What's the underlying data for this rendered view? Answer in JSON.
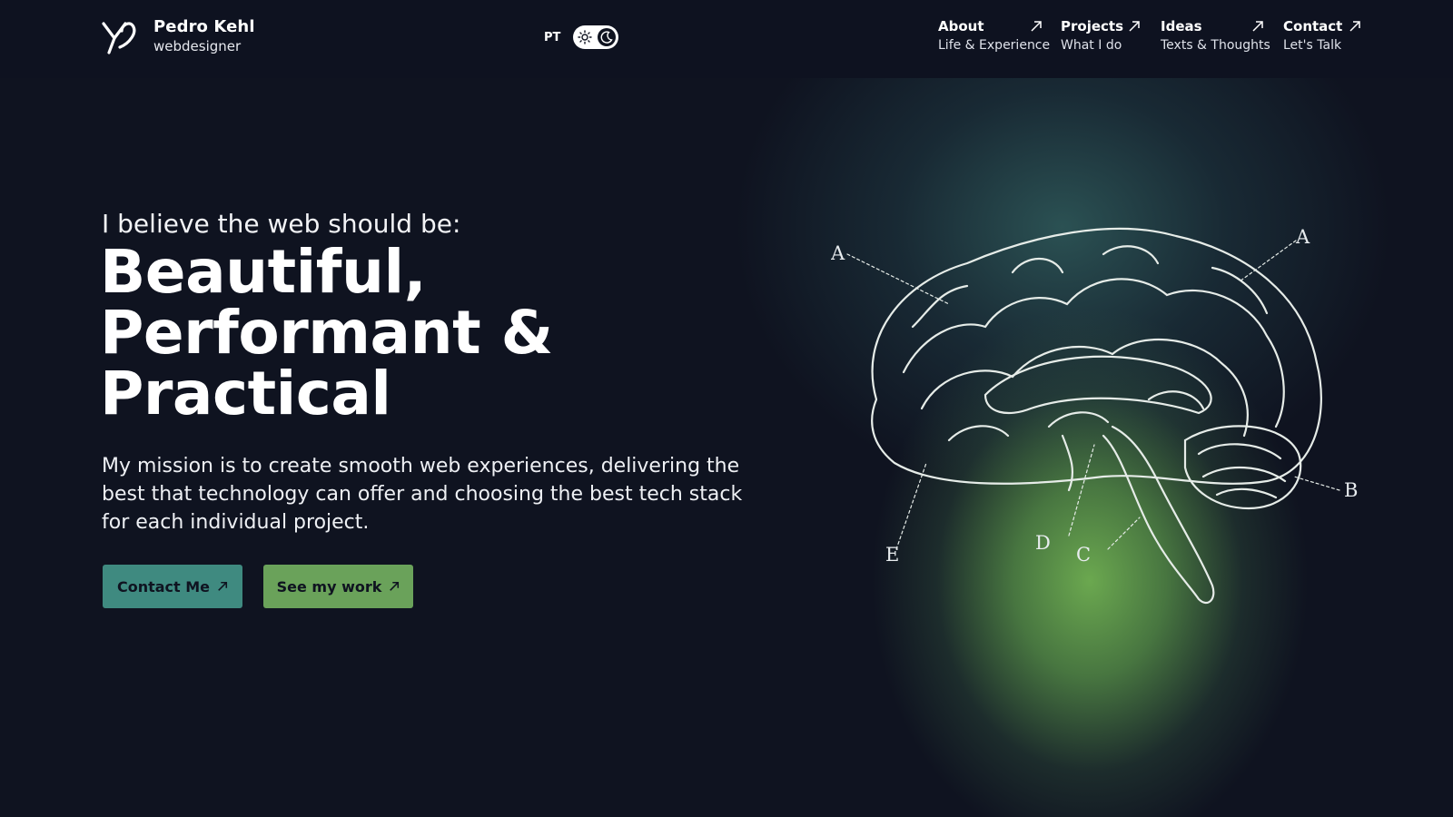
{
  "brand": {
    "name": "Pedro Kehl",
    "role": "webdesigner",
    "logo_icon": "pk-monogram-icon"
  },
  "language": {
    "label": "PT"
  },
  "theme_toggle": {
    "light_icon": "sun-icon",
    "dark_icon": "moon-icon",
    "state": "dark"
  },
  "nav": [
    {
      "title": "About",
      "subtitle": "Life & Experience",
      "icon": "arrow-up-right-icon"
    },
    {
      "title": "Projects",
      "subtitle": "What I do",
      "icon": "arrow-up-right-icon"
    },
    {
      "title": "Ideas",
      "subtitle": "Texts & Thoughts",
      "icon": "arrow-up-right-icon"
    },
    {
      "title": "Contact",
      "subtitle": "Let's Talk",
      "icon": "arrow-up-right-icon"
    }
  ],
  "hero": {
    "lead": "I believe the web should be:",
    "title_lines": [
      "Beautiful,",
      "Performant &",
      "Practical"
    ],
    "mission": "My mission is to create smooth web experiences, delivering the best that technology can offer and choosing the best tech stack for each individual project.",
    "buttons": {
      "contact": "Contact Me",
      "work": "See my work"
    }
  },
  "illustration": {
    "labels": {
      "a1": "A",
      "a2": "A",
      "b": "B",
      "c": "C",
      "d": "D",
      "e": "E"
    }
  },
  "colors": {
    "background": "#0f1320",
    "contact_button": "#3f8a80",
    "work_button": "#6aa25a",
    "glow_green": "#70b052",
    "glow_teal": "#305c5c"
  }
}
